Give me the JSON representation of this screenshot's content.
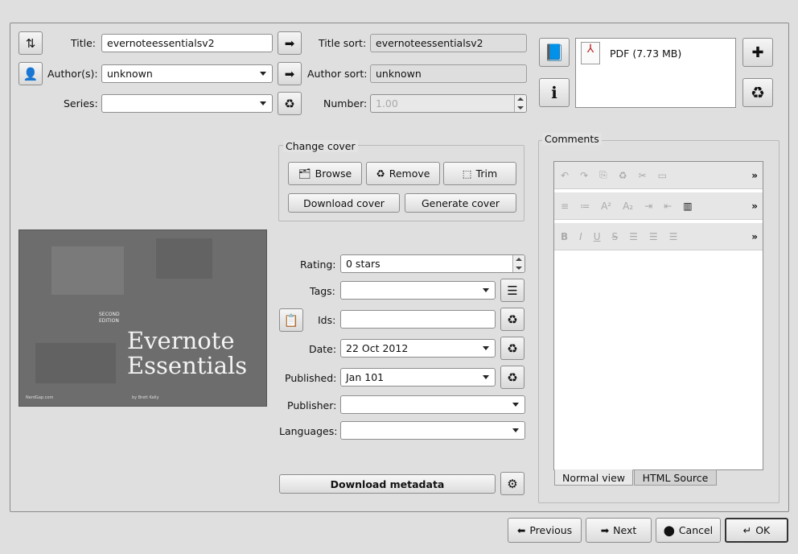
{
  "fields": {
    "title_label": "Title:",
    "title_value": "evernoteessentialsv2",
    "title_sort_label": "Title sort:",
    "title_sort_value": "evernoteessentialsv2",
    "author_label": "Author(s):",
    "author_value": "unknown",
    "author_sort_label": "Author sort:",
    "author_sort_value": "unknown",
    "series_label": "Series:",
    "series_value": "",
    "number_label": "Number:",
    "number_value": "1.00"
  },
  "formats": {
    "items": [
      {
        "label": "PDF (7.73 MB)"
      }
    ]
  },
  "cover": {
    "group_label": "Change cover",
    "browse": "Browse",
    "remove": "Remove",
    "trim": "Trim",
    "download": "Download cover",
    "generate": "Generate cover",
    "book_edition": "SECOND\nEDITION",
    "book_title_1": "Evernote",
    "book_title_2": "Essentials",
    "book_publisher": "NerdGap.com",
    "book_author": "by Brett Kelly"
  },
  "metadata": {
    "rating_label": "Rating:",
    "rating_value": "0 stars",
    "tags_label": "Tags:",
    "tags_value": "",
    "ids_label": "Ids:",
    "ids_value": "",
    "date_label": "Date:",
    "date_value": "22 Oct 2012",
    "published_label": "Published:",
    "published_value": "Jan 101",
    "publisher_label": "Publisher:",
    "publisher_value": "",
    "languages_label": "Languages:",
    "languages_value": "",
    "download_metadata": "Download metadata"
  },
  "comments": {
    "label": "Comments",
    "tab_normal": "Normal view",
    "tab_html": "HTML Source"
  },
  "footer": {
    "previous": "Previous",
    "next": "Next",
    "cancel": "Cancel",
    "ok": "OK"
  }
}
